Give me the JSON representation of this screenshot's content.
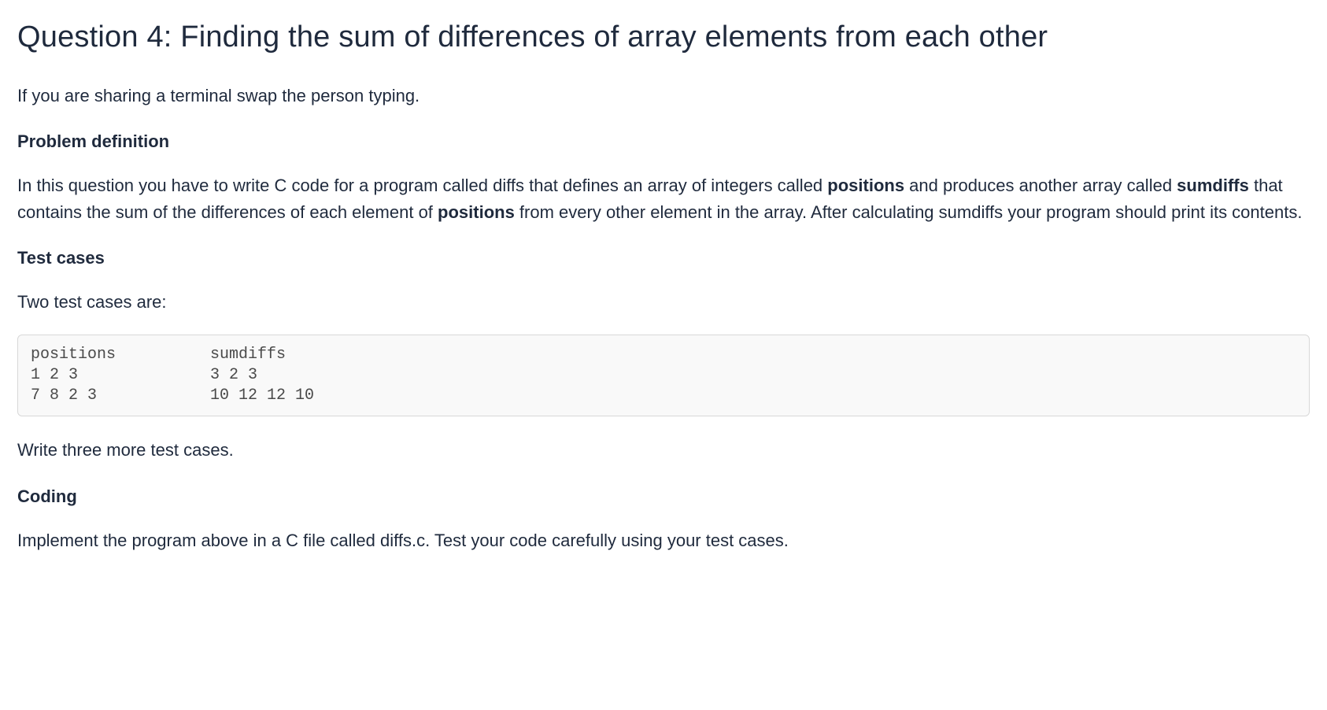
{
  "title": "Question 4: Finding the sum of differences of array elements from each other",
  "intro": "If you are sharing a terminal swap the person typing.",
  "sections": {
    "problem_def_head": "Problem definition",
    "problem_def_body": {
      "p1_a": "In this question you have to write C code for a program called diffs that defines an array of integers called ",
      "p1_b": "positions",
      "p1_c": " and produces another array called ",
      "p1_d": "sumdiffs",
      "p1_e": " that contains the sum of the differences of each element of ",
      "p1_f": "positions",
      "p1_g": " from every other element in the array. After calculating sumdiffs your program should print its contents."
    },
    "test_cases_head": "Test cases",
    "test_cases_intro": "Two test cases are:",
    "test_cases_code": "positions          sumdiffs\n1 2 3              3 2 3\n7 8 2 3            10 12 12 10",
    "test_cases_write": "Write three more test cases.",
    "coding_head": "Coding",
    "coding_body": "Implement the program above in a C file called diffs.c.  Test your code carefully using your test cases."
  }
}
